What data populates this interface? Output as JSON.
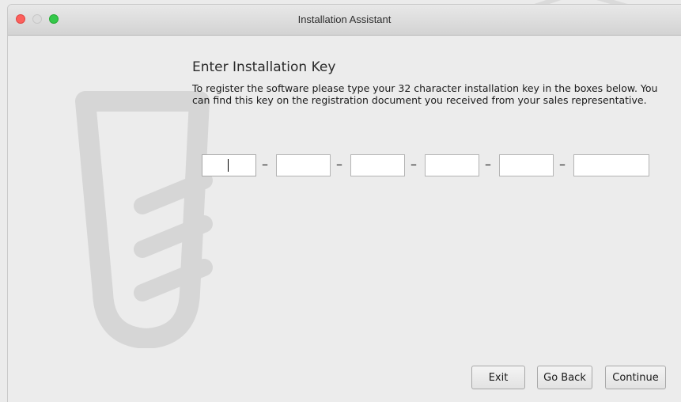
{
  "window": {
    "title": "Installation Assistant"
  },
  "content": {
    "heading": "Enter Installation Key",
    "description": "To register the software please type your 32 character installation key in the boxes below. You can find this key on the registration document you received from your sales representative.",
    "key_fields": [
      {
        "value": ""
      },
      {
        "value": ""
      },
      {
        "value": ""
      },
      {
        "value": ""
      },
      {
        "value": ""
      },
      {
        "value": ""
      }
    ],
    "separator": "–"
  },
  "buttons": {
    "exit": "Exit",
    "go_back": "Go Back",
    "continue": "Continue"
  },
  "colors": {
    "close": "#fc605c",
    "minimize": "#dcdcdc",
    "maximize": "#34c84a",
    "watermark": "#d6d6d6"
  },
  "icons": {
    "watermark": "sensor-probe-icon"
  }
}
